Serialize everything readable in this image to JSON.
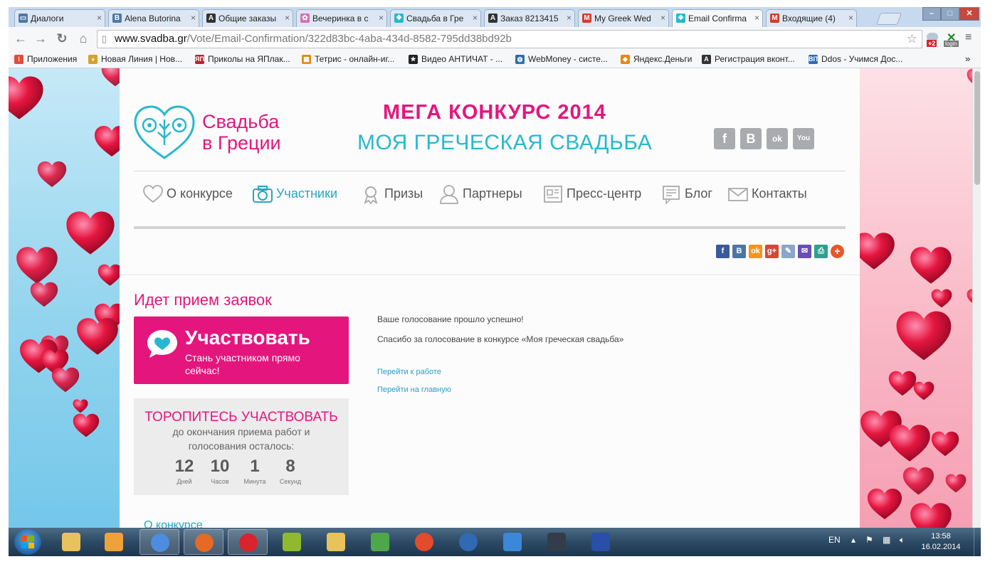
{
  "browser": {
    "tabs": [
      {
        "label": "Диалоги",
        "fav_color": "#4f78a7",
        "fav_glyph": "▭",
        "active": false
      },
      {
        "label": "Alena Butorina",
        "fav_color": "#4f78a7",
        "fav_glyph": "B",
        "active": false
      },
      {
        "label": "Общие заказы",
        "fav_color": "#333333",
        "fav_glyph": "A",
        "active": false
      },
      {
        "label": "Вечеринка в с",
        "fav_color": "#d86fb0",
        "fav_glyph": "✿",
        "active": false
      },
      {
        "label": "Свадьба в Гре",
        "fav_color": "#27b8cf",
        "fav_glyph": "❖",
        "active": false
      },
      {
        "label": "Заказ 8213415",
        "fav_color": "#333333",
        "fav_glyph": "A",
        "active": false
      },
      {
        "label": "My Greek Wed",
        "fav_color": "#d93a2b",
        "fav_glyph": "M",
        "active": false
      },
      {
        "label": "Email Confirma",
        "fav_color": "#27b8cf",
        "fav_glyph": "❖",
        "active": true
      },
      {
        "label": "Входящие (4)",
        "fav_color": "#d93a2b",
        "fav_glyph": "M",
        "active": false
      }
    ],
    "url_host": "www.svadba.gr",
    "url_path": "/Vote/Email-Confirmation/322d83bc-4aba-434d-8582-795dd38bd92b",
    "bookmarks": [
      {
        "label": "Приложения",
        "color": "#e44b3a",
        "glyph": "⁝"
      },
      {
        "label": "Новая Линия | Нов...",
        "color": "#d7a22b",
        "glyph": "◕"
      },
      {
        "label": "Приколы на ЯПлак...",
        "color": "#c0202a",
        "glyph": "ЯП"
      },
      {
        "label": "Тетрис - онлайн-иг...",
        "color": "#e58a13",
        "glyph": "▦"
      },
      {
        "label": "Видео АНТИЧАТ - ...",
        "color": "#222222",
        "glyph": "★"
      },
      {
        "label": "WebMoney - систе...",
        "color": "#2d6cb5",
        "glyph": "◍"
      },
      {
        "label": "Яндекс.Деньги",
        "color": "#e58a13",
        "glyph": "◆"
      },
      {
        "label": "Регистрация вконт...",
        "color": "#333333",
        "glyph": "A"
      },
      {
        "label": "Ddos - Учимся Дос...",
        "color": "#2d6cb5",
        "glyph": "BIT"
      }
    ],
    "ext_badge": "+2",
    "ext_login": "login"
  },
  "site": {
    "logo_line1": "Свадьба",
    "logo_line2": "в Греции",
    "headline1": "МЕГА КОНКУРС 2014",
    "headline2": "МОЯ ГРЕЧЕСКАЯ СВАДЬБА",
    "social": [
      {
        "name": "facebook",
        "glyph": "f"
      },
      {
        "name": "vkontakte",
        "glyph": "B"
      },
      {
        "name": "odnoklassniki",
        "glyph": "ok"
      },
      {
        "name": "youtube",
        "glyph": "You"
      }
    ],
    "menu": [
      {
        "label": "О конкурсе",
        "icon": "heart-outline-icon",
        "active": false
      },
      {
        "label": "Участники",
        "icon": "camera-icon",
        "active": true
      },
      {
        "label": "Призы",
        "icon": "award-icon",
        "active": false
      },
      {
        "label": "Партнеры",
        "icon": "user-icon",
        "active": false
      },
      {
        "label": "Пресс-центр",
        "icon": "newspaper-icon",
        "active": false
      },
      {
        "label": "Блог",
        "icon": "notepad-icon",
        "active": false
      },
      {
        "label": "Контакты",
        "icon": "envelope-icon",
        "active": false
      }
    ],
    "share": [
      {
        "name": "facebook",
        "glyph": "f",
        "color": "#3b5998"
      },
      {
        "name": "vkontakte",
        "glyph": "B",
        "color": "#4c75a3"
      },
      {
        "name": "odnoklassniki",
        "glyph": "ok",
        "color": "#f59320"
      },
      {
        "name": "google-plus",
        "glyph": "g+",
        "color": "#d34836"
      },
      {
        "name": "livejournal",
        "glyph": "✎",
        "color": "#8aa6c9"
      },
      {
        "name": "mail",
        "glyph": "✉",
        "color": "#6a4fb3"
      },
      {
        "name": "print",
        "glyph": "⎙",
        "color": "#2aa28e"
      },
      {
        "name": "more",
        "glyph": "+",
        "color": "#e8562a"
      }
    ],
    "accept_title": "Идет прием заявок",
    "participate_big": "Участвовать",
    "participate_small": "Стань участником прямо сейчас!",
    "hurry_title": "ТОРОПИТЕСЬ УЧАСТВОВАТЬ",
    "hurry_sub": "до окончания приема работ и голосования осталось:",
    "countdown": [
      {
        "value": "12",
        "label": "Дней"
      },
      {
        "value": "10",
        "label": "Часов"
      },
      {
        "value": "1",
        "label": "Минута"
      },
      {
        "value": "8",
        "label": "Секунд"
      }
    ],
    "about_link": "О конкурсе",
    "msg_success": "Ваше голосование прошло успешно!",
    "msg_thanks": "Спасибо за голосование в конкурсе «Моя греческая свадьба»",
    "link_work": "Перейти к работе",
    "link_home": "Перейти на главную"
  },
  "taskbar": {
    "lang": "EN",
    "time": "13:58",
    "date": "16.02.2014",
    "apps": [
      {
        "name": "explorer",
        "color": "#e8c25a",
        "open": false
      },
      {
        "name": "media-player",
        "color": "#f0a23a",
        "open": false
      },
      {
        "name": "chrome",
        "color": "#4c8de0",
        "open": true
      },
      {
        "name": "firefox",
        "color": "#e46a25",
        "open": true
      },
      {
        "name": "opera",
        "color": "#d9232e",
        "open": true
      },
      {
        "name": "game",
        "color": "#8fba2e",
        "open": false
      },
      {
        "name": "image-viewer",
        "color": "#e8c25a",
        "open": false
      },
      {
        "name": "editor",
        "color": "#4ea84b",
        "open": false
      },
      {
        "name": "power",
        "color": "#e24b2b",
        "open": false
      },
      {
        "name": "shutdown",
        "color": "#2f6ab3",
        "open": false
      },
      {
        "name": "sync",
        "color": "#3b87d8",
        "open": false
      },
      {
        "name": "steam",
        "color": "#333c48",
        "open": false
      },
      {
        "name": "save",
        "color": "#2a4fa8",
        "open": false
      }
    ]
  }
}
